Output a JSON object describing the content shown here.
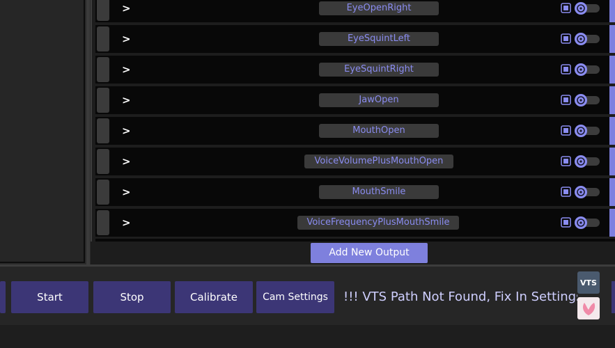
{
  "outputs": [
    {
      "name": "EyeOpenRight"
    },
    {
      "name": "EyeSquintLeft"
    },
    {
      "name": "EyeSquintRight"
    },
    {
      "name": "JawOpen"
    },
    {
      "name": "MouthOpen"
    },
    {
      "name": "VoiceVolumePlusMouthOpen"
    },
    {
      "name": "MouthSmile"
    },
    {
      "name": "VoiceFrequencyPlusMouthSmile"
    }
  ],
  "chevron": ">",
  "add_button": "Add New Output",
  "toolbar": {
    "start": "Start",
    "stop": "Stop",
    "calibrate": "Calibrate",
    "cam_settings": "Cam Settings",
    "status": "!!!   VTS Path Not Found, Fix In Settings"
  },
  "colors": {
    "accent": "#7e80dd",
    "name_text": "#8a8cf0",
    "button_bg": "#3c3676",
    "row_bg": "#080808"
  },
  "icons": [
    "chevron-right-icon",
    "copy-icon",
    "face-tracking-icon",
    "vts-logo",
    "app-logo"
  ]
}
